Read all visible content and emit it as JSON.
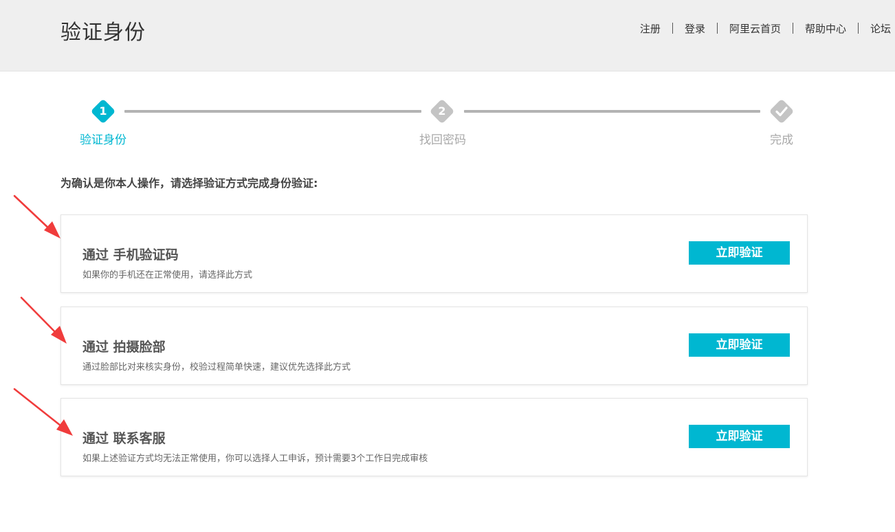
{
  "header": {
    "title": "验证身份",
    "nav": [
      "注册",
      "登录",
      "阿里云首页",
      "帮助中心",
      "论坛"
    ]
  },
  "steps": [
    {
      "number": "1",
      "label": "验证身份",
      "state": "active"
    },
    {
      "number": "2",
      "label": "找回密码",
      "state": "inactive"
    },
    {
      "icon": "check-icon",
      "label": "完成",
      "state": "inactive"
    }
  ],
  "instruction": "为确认是你本人操作，请选择验证方式完成身份验证:",
  "options": [
    {
      "title": "通过 手机验证码",
      "desc": "如果你的手机还在正常使用，请选择此方式",
      "button": "立即验证"
    },
    {
      "title": "通过 拍摄脸部",
      "desc": "通过脸部比对来核实身份，校验过程简单快速，建议优先选择此方式",
      "button": "立即验证"
    },
    {
      "title": "通过 联系客服",
      "desc": "如果上述验证方式均无法正常使用，你可以选择人工申诉，预计需要3个工作日完成审核",
      "button": "立即验证"
    }
  ],
  "colors": {
    "accent": "#00b7d1",
    "inactive": "#c4c4c4",
    "annotation_arrow": "#f03c3c"
  }
}
